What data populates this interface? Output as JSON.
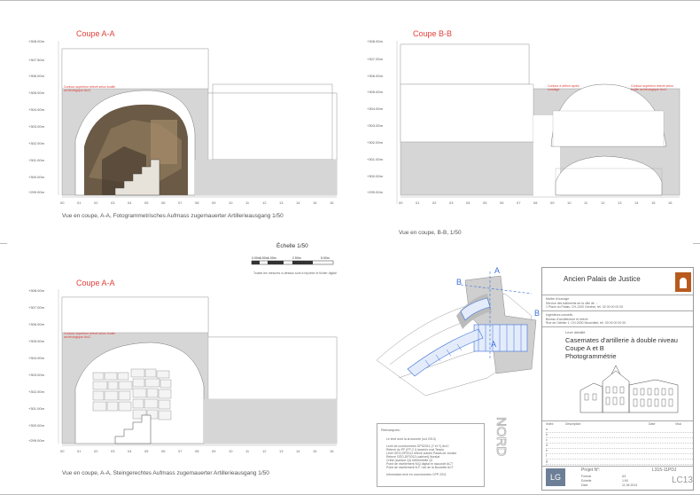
{
  "sections": {
    "top_left": {
      "title": "Coupe A-A",
      "caption": "Vue en coupe, A-A, Fotogrammetrisches Aufmass zugemauerter Artillerieausgang 1/50",
      "note": "Contour supérieur relevé selon fouille archéologique ArcC",
      "levels": [
        "+308.00m",
        "+307.50m",
        "+306.00m",
        "+305.00m",
        "+304.00m",
        "+303.00m",
        "+302.00m",
        "+301.00m",
        "+300.00m",
        "+299.00m"
      ],
      "axis": [
        "00",
        "01",
        "02",
        "03",
        "04",
        "05",
        "06",
        "07",
        "08",
        "09",
        "10",
        "11",
        "12",
        "13",
        "14",
        "15",
        "16"
      ]
    },
    "top_right": {
      "title": "Coupe B-B",
      "caption": "Vue en coupe, B-B, 1/50",
      "note_left": "Contour à définir après sondage",
      "note_right": "Contour supérieur relevé selon fouille archéologique ArcC",
      "levels": [
        "+308.00m",
        "+307.00m",
        "+306.00m",
        "+305.00m",
        "+304.00m",
        "+303.00m",
        "+302.00m",
        "+301.00m",
        "+300.00m",
        "+299.00m"
      ],
      "axis": [
        "00",
        "01",
        "02",
        "03",
        "04",
        "05",
        "06",
        "07",
        "08",
        "09",
        "10",
        "11",
        "12",
        "13",
        "14",
        "15",
        "16"
      ]
    },
    "bottom_left": {
      "title": "Coupe A-A",
      "caption": "Vue en coupe, A-A, Steingerechtes Aufmass zugemauerter Artillerieausgang 1/50",
      "note": "Contour supérieur relevé selon fouille archéologique ArcC",
      "levels": [
        "+308.00m",
        "+307.00m",
        "+306.00m",
        "+305.00m",
        "+304.00m",
        "+303.00m",
        "+302.00m",
        "+301.00m",
        "+300.00m",
        "+299.00m"
      ],
      "axis": [
        "00",
        "01",
        "02",
        "03",
        "04",
        "05",
        "06",
        "07",
        "08",
        "09",
        "10",
        "11",
        "12",
        "13",
        "14",
        "15",
        "16"
      ]
    }
  },
  "scale": {
    "title": "Échelle 1/50",
    "marks": [
      "0.00m",
      "0.50m",
      "1.00m",
      "2.50m",
      "5.00m"
    ],
    "note": "Toutes les mesures ci-dessus sont à reporter le fichier digital"
  },
  "plan": {
    "label_a_top": "A",
    "label_a_bottom": "A",
    "label_b_top": "B",
    "label_b_bottom": "B",
    "north": "NORD"
  },
  "remarks": {
    "title": "Remarques:",
    "lines": [
      "Le levé dont la la donnée (oct 2013)",
      "Levé de coordonnées GPS2011 (Y et Y) ArcC",
      "Relevé du PF (FP-2 I) lancé/nr mai Tessin",
      "Levé GÉO-DP2012 relevé ancien Palais de Justice",
      "Relevé GÉO-DP2013 (cabinet) Nurslat",
      "Crête (surface QI) referentielle Ql",
      "Point de nivellement N/Q digital et raccordé ACT",
      "Point de nivellement N.F. l'art de la Bourette ACT",
      "Information levé en coordonnées CPP 2011"
    ]
  },
  "title_block": {
    "project": "Ancien Palais de Justice",
    "client_label": "Maître d'ouvrage",
    "client_lines": [
      "Service des bâtiments de la ville de ...",
      "1 Place du Palais, CH-1200 Genève, tél. 02 00 00 00 00"
    ],
    "engineer_label": "Ingénieurs-conseils",
    "engineer_lines": [
      "Bureau d'architecture et relevé",
      "Rue de l'Atelier 1, CH-2000 Neuchâtel, tél. 03 00 00 00 00"
    ],
    "doc_type": "Levé détaillé",
    "title_lines": [
      "Casemates d'artillerie à double niveau",
      "Coupe A et B",
      "Photogrammétrie"
    ],
    "index_headers": [
      "Index",
      "Description",
      "Date",
      "Visa"
    ],
    "index_rows": [
      "a",
      "b",
      "c",
      "d",
      "e",
      "f",
      "g"
    ],
    "project_no_label": "Projet N°:",
    "project_no": "L315-11PDJ",
    "meta": [
      {
        "k": "Format",
        "v": "A3"
      },
      {
        "k": "Echelle",
        "v": "1:50"
      },
      {
        "k": "Date",
        "v": "11.06.2013"
      }
    ],
    "sheet_id": "LC13",
    "logo_text": "LG"
  },
  "colors": {
    "accent_red": "#e0413c",
    "plan_blue": "#3a6fd8",
    "fill_gray": "#cfcfcf",
    "logo_orange": "#b85a1e"
  }
}
